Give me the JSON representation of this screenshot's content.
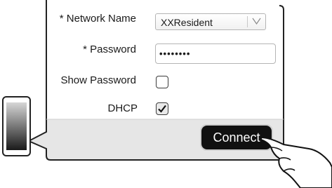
{
  "form": {
    "network_name_label": "* Network Name",
    "network_name_value": "XXResident",
    "password_label": "* Password",
    "password_value": "••••••••",
    "show_password_label": "Show Password",
    "show_password_checked": false,
    "dhcp_label": "DHCP",
    "dhcp_checked": true
  },
  "actions": {
    "connect_label": "Connect"
  },
  "icons": {
    "dropdown": "chevron-down-icon",
    "check": "checkmark-icon",
    "hand": "pointing-hand-icon",
    "phone": "phone-icon"
  }
}
